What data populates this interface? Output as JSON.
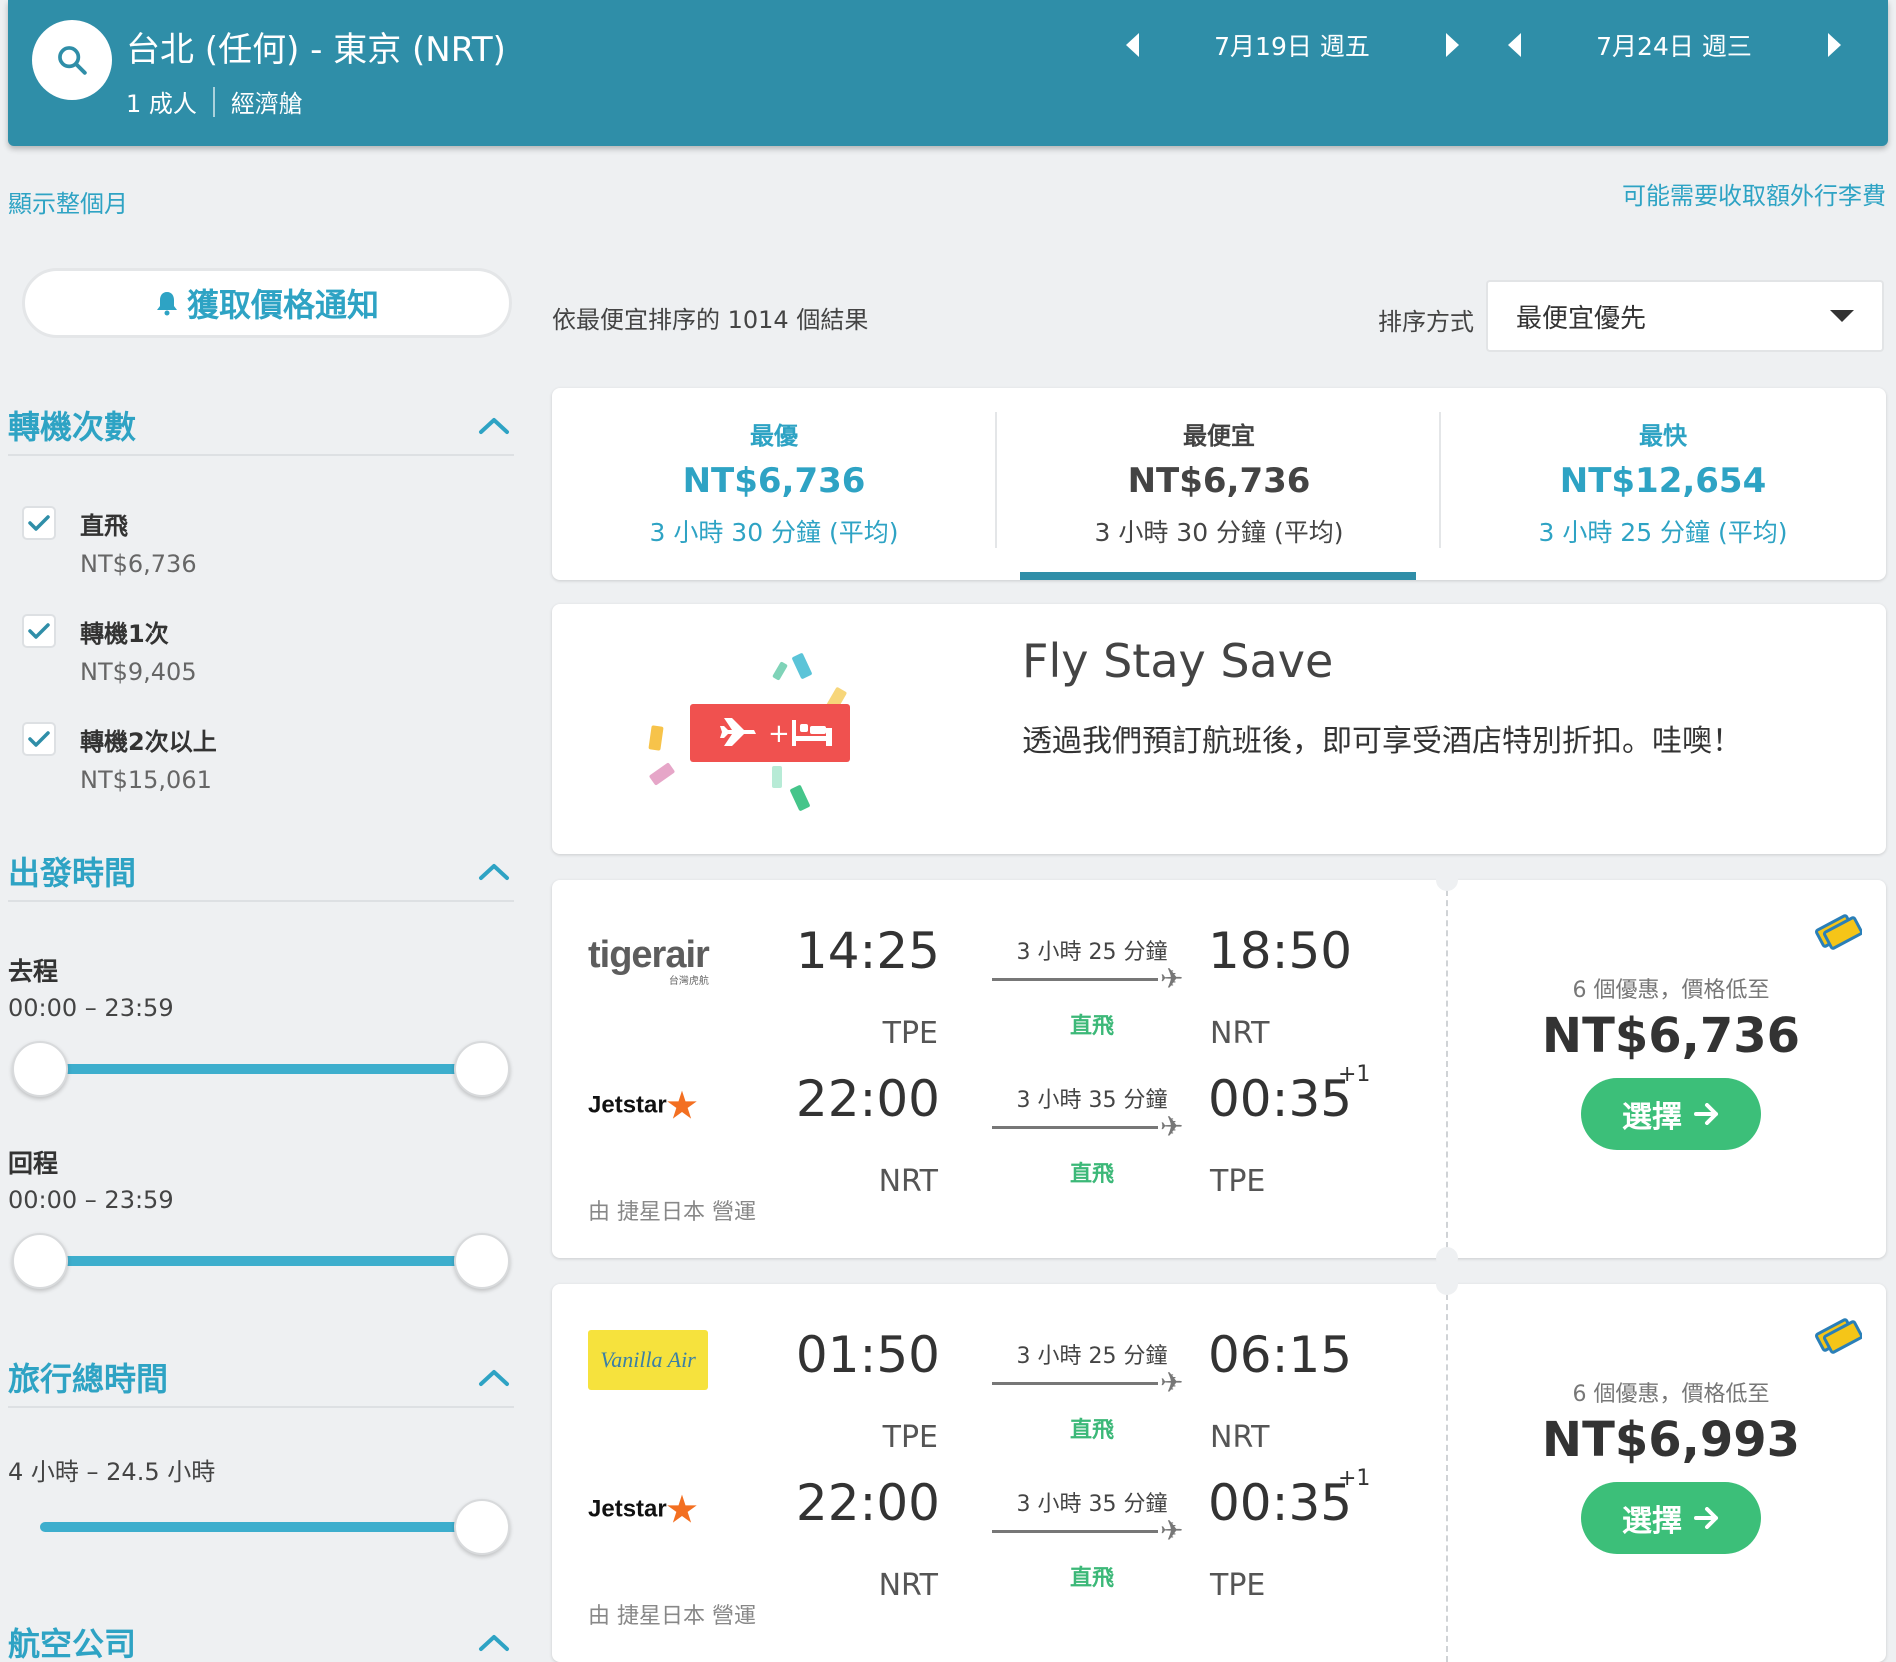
{
  "header": {
    "route": "台北 (任何) - 東京 (NRT)",
    "passengers": "1 成人",
    "cabin": "經濟艙",
    "depart_date": "7月19日 週五",
    "return_date": "7月24日 週三"
  },
  "links": {
    "show_month": "顯示整個月",
    "baggage_fee": "可能需要收取額外行李費"
  },
  "sidebar": {
    "price_alert": "獲取價格通知",
    "stops": {
      "title": "轉機次數",
      "options": [
        {
          "label": "直飛",
          "price": "NT$6,736",
          "checked": true
        },
        {
          "label": "轉機1次",
          "price": "NT$9,405",
          "checked": true
        },
        {
          "label": "轉機2次以上",
          "price": "NT$15,061",
          "checked": true
        }
      ]
    },
    "departure_time": {
      "title": "出發時間",
      "outbound_label": "去程",
      "outbound_range": "00:00 – 23:59",
      "return_label": "回程",
      "return_range": "00:00 – 23:59"
    },
    "duration": {
      "title": "旅行總時間",
      "range": "4 小時 – 24.5 小時"
    },
    "airlines": {
      "title": "航空公司"
    }
  },
  "results": {
    "count_text": "依最便宜排序的 1014 個結果",
    "sort_label": "排序方式",
    "sort_value": "最便宜優先"
  },
  "tabs": [
    {
      "label": "最優",
      "price": "NT$6,736",
      "duration": "3 小時 30 分鐘 (平均)"
    },
    {
      "label": "最便宜",
      "price": "NT$6,736",
      "duration": "3 小時 30 分鐘 (平均)"
    },
    {
      "label": "最快",
      "price": "NT$12,654",
      "duration": "3 小時 25 分鐘 (平均)"
    }
  ],
  "promo": {
    "title": "Fly Stay Save",
    "text": "透過我們預訂航班後，即可享受酒店特別折扣。哇噢！"
  },
  "flights": [
    {
      "outbound": {
        "airline": "tigerair",
        "airline_sub": "台灣虎航",
        "dep_time": "14:25",
        "dep_code": "TPE",
        "duration": "3 小時 25 分鐘",
        "stops": "直飛",
        "arr_time": "18:50",
        "arr_code": "NRT"
      },
      "inbound": {
        "airline": "Jetstar",
        "dep_time": "22:00",
        "dep_code": "NRT",
        "duration": "3 小時 35 分鐘",
        "stops": "直飛",
        "arr_time": "00:35",
        "arr_code": "TPE",
        "day_offset": "+1"
      },
      "operated_by": "由 捷星日本 營運",
      "deals": "6 個優惠，價格低至",
      "price": "NT$6,736",
      "select_label": "選擇"
    },
    {
      "outbound": {
        "airline": "Vanilla Air",
        "dep_time": "01:50",
        "dep_code": "TPE",
        "duration": "3 小時 25 分鐘",
        "stops": "直飛",
        "arr_time": "06:15",
        "arr_code": "NRT"
      },
      "inbound": {
        "airline": "Jetstar",
        "dep_time": "22:00",
        "dep_code": "NRT",
        "duration": "3 小時 35 分鐘",
        "stops": "直飛",
        "arr_time": "00:35",
        "arr_code": "TPE",
        "day_offset": "+1"
      },
      "operated_by": "由 捷星日本 營運",
      "deals": "6 個優惠，價格低至",
      "price": "NT$6,993",
      "select_label": "選擇"
    }
  ],
  "colors": {
    "header_bg": "#2f8ea8",
    "accent": "#2ea3c4",
    "select_green": "#3cbf79",
    "promo_red": "#f0514f"
  }
}
